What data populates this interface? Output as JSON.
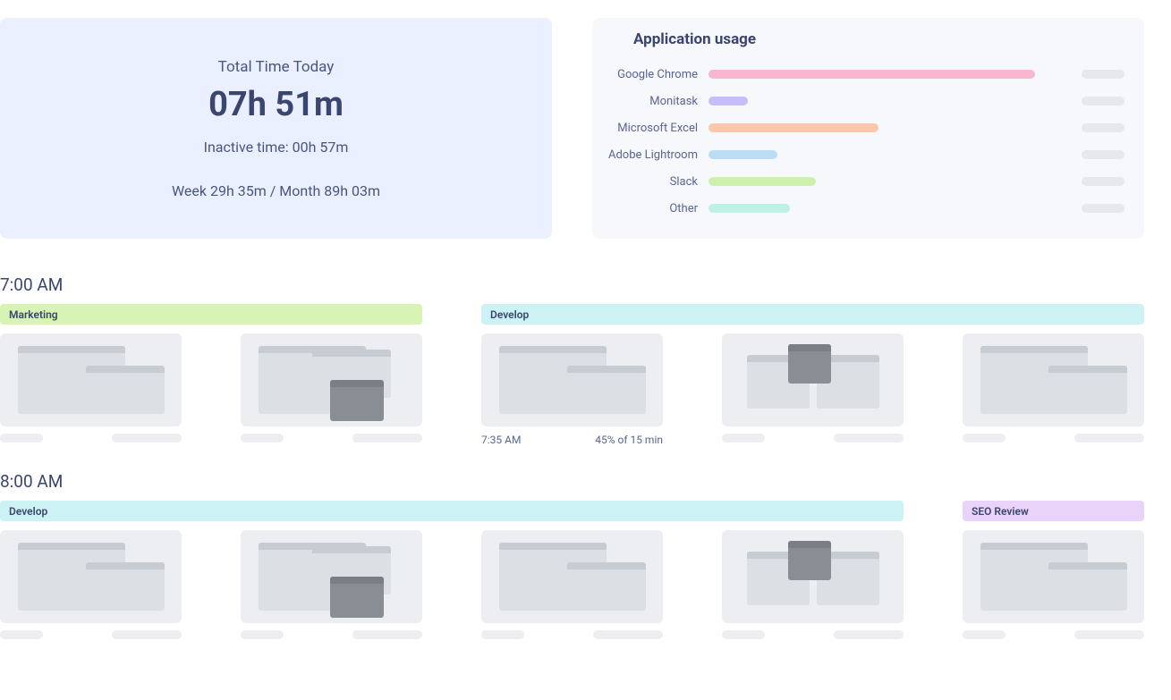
{
  "summary": {
    "label": "Total Time Today",
    "total": "07h 51m",
    "inactive": "Inactive time: 00h 57m",
    "periods": "Week 29h 35m  /   Month 89h 03m"
  },
  "usage": {
    "title": "Application usage",
    "apps": [
      {
        "name": "Google Chrome",
        "pct": 100,
        "color": "#f9b6cf"
      },
      {
        "name": "Monitask",
        "pct": 12,
        "color": "#c7bdf8"
      },
      {
        "name": "Microsoft Excel",
        "pct": 52,
        "color": "#f7c8a9"
      },
      {
        "name": "Adobe Lightroom",
        "pct": 21,
        "color": "#bcdcf3"
      },
      {
        "name": "Slack",
        "pct": 33,
        "color": "#cdf1ad"
      },
      {
        "name": "Other",
        "pct": 25,
        "color": "#bef0e5"
      }
    ]
  },
  "timeline": [
    {
      "time": "7:00 AM",
      "tags": [
        {
          "label": "Marketing",
          "color": "green",
          "span": 2
        },
        {
          "label": "Develop",
          "color": "cyan",
          "span": 3
        }
      ],
      "shots": [
        {
          "variant": "two",
          "meta_type": "stub"
        },
        {
          "variant": "two-dark",
          "meta_type": "stub"
        },
        {
          "variant": "two",
          "meta_type": "text",
          "left": "7:35 AM",
          "right": "45% of 15 min"
        },
        {
          "variant": "dark-center",
          "meta_type": "stub"
        },
        {
          "variant": "two",
          "meta_type": "stub"
        }
      ]
    },
    {
      "time": "8:00 AM",
      "tags": [
        {
          "label": "Develop",
          "color": "cyan",
          "span": 4
        },
        {
          "label": "SEO Review",
          "color": "purple",
          "span": 1
        }
      ],
      "shots": [
        {
          "variant": "two",
          "meta_type": "stub"
        },
        {
          "variant": "two-dark",
          "meta_type": "stub"
        },
        {
          "variant": "two",
          "meta_type": "stub"
        },
        {
          "variant": "dark-center",
          "meta_type": "stub"
        },
        {
          "variant": "two",
          "meta_type": "stub"
        }
      ]
    }
  ],
  "chart_data": {
    "type": "bar",
    "title": "Application usage",
    "categories": [
      "Google Chrome",
      "Monitask",
      "Microsoft Excel",
      "Adobe Lightroom",
      "Slack",
      "Other"
    ],
    "values": [
      100,
      12,
      52,
      21,
      33,
      25
    ],
    "xlabel": "",
    "ylabel": "",
    "ylim": [
      0,
      100
    ]
  }
}
